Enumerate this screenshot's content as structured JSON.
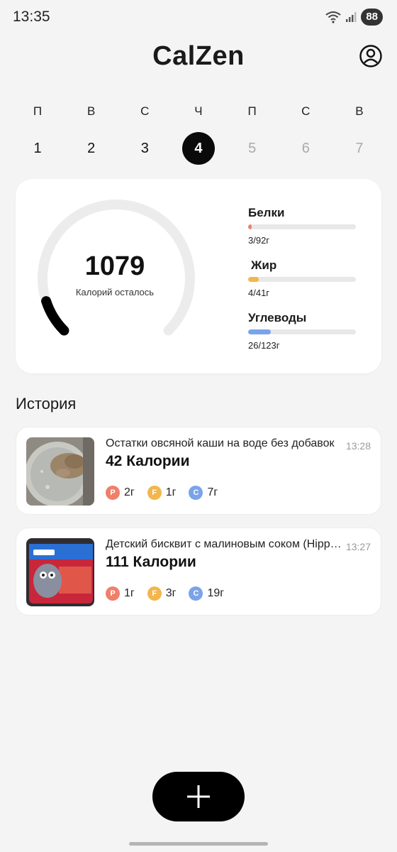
{
  "status": {
    "time": "13:35",
    "battery": "88"
  },
  "app": {
    "title": "CalZen"
  },
  "week": {
    "days": [
      {
        "letter": "П",
        "num": "1"
      },
      {
        "letter": "В",
        "num": "2"
      },
      {
        "letter": "С",
        "num": "3"
      },
      {
        "letter": "Ч",
        "num": "4"
      },
      {
        "letter": "П",
        "num": "5"
      },
      {
        "letter": "С",
        "num": "6"
      },
      {
        "letter": "В",
        "num": "7"
      }
    ],
    "selected_index": 3
  },
  "summary": {
    "calories_left": "1079",
    "calories_label": "Калорий осталось",
    "ring_progress": 0.1,
    "macros": [
      {
        "name": "Белки",
        "value": "3/92г",
        "fraction": 0.033,
        "color": "#f07f6a"
      },
      {
        "name": "Жир",
        "value": "4/41г",
        "fraction": 0.098,
        "color": "#f2b64c"
      },
      {
        "name": "Углеводы",
        "value": "26/123г",
        "fraction": 0.211,
        "color": "#7aa3ea"
      }
    ]
  },
  "history": {
    "title": "История",
    "entries": [
      {
        "name": "Остатки овсяной каши на воде без добавок",
        "time": "13:28",
        "kcal": "42 Калории",
        "protein": "2г",
        "fat": "1г",
        "carbs": "7г"
      },
      {
        "name": "Детский бисквит с малиновым соком (Hippo Friends)",
        "time": "13:27",
        "kcal": "111 Калории",
        "protein": "1г",
        "fat": "3г",
        "carbs": "19г"
      }
    ]
  },
  "chips": {
    "protein_letter": "P",
    "fat_letter": "F",
    "carbs_letter": "C"
  },
  "colors": {
    "protein": "#f07f6a",
    "fat": "#f2b64c",
    "carbs": "#7aa3ea",
    "accent": "#000000"
  }
}
